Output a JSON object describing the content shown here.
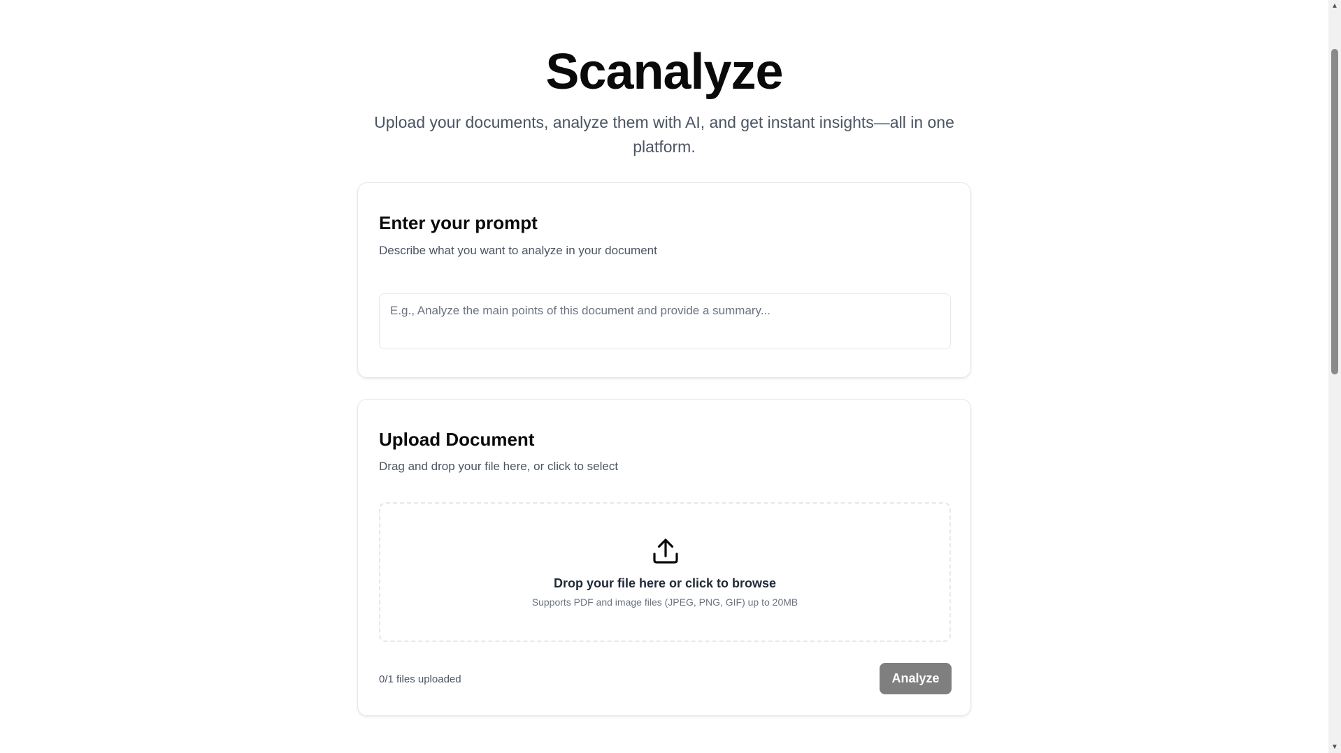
{
  "header": {
    "title": "Scanalyze",
    "subtitle": "Upload your documents, analyze them with AI, and get instant insights—all in one platform."
  },
  "prompt_card": {
    "title": "Enter your prompt",
    "description": "Describe what you want to analyze in your document",
    "input_value": "",
    "input_placeholder": "E.g., Analyze the main points of this document and provide a summary..."
  },
  "upload_card": {
    "title": "Upload Document",
    "description": "Drag and drop your file here, or click to select",
    "dropzone": {
      "icon": "upload-icon",
      "main_text": "Drop your file here or click to browse",
      "sub_text": "Supports PDF and image files (JPEG, PNG, GIF) up to 20MB"
    },
    "files_count": "0/1 files uploaded",
    "analyze_label": "Analyze",
    "analyze_button_color": "#7f7f7f"
  },
  "scrollbar": {
    "up_icon": "scroll-up-arrow-icon",
    "down_icon": "scroll-down-arrow-icon"
  }
}
